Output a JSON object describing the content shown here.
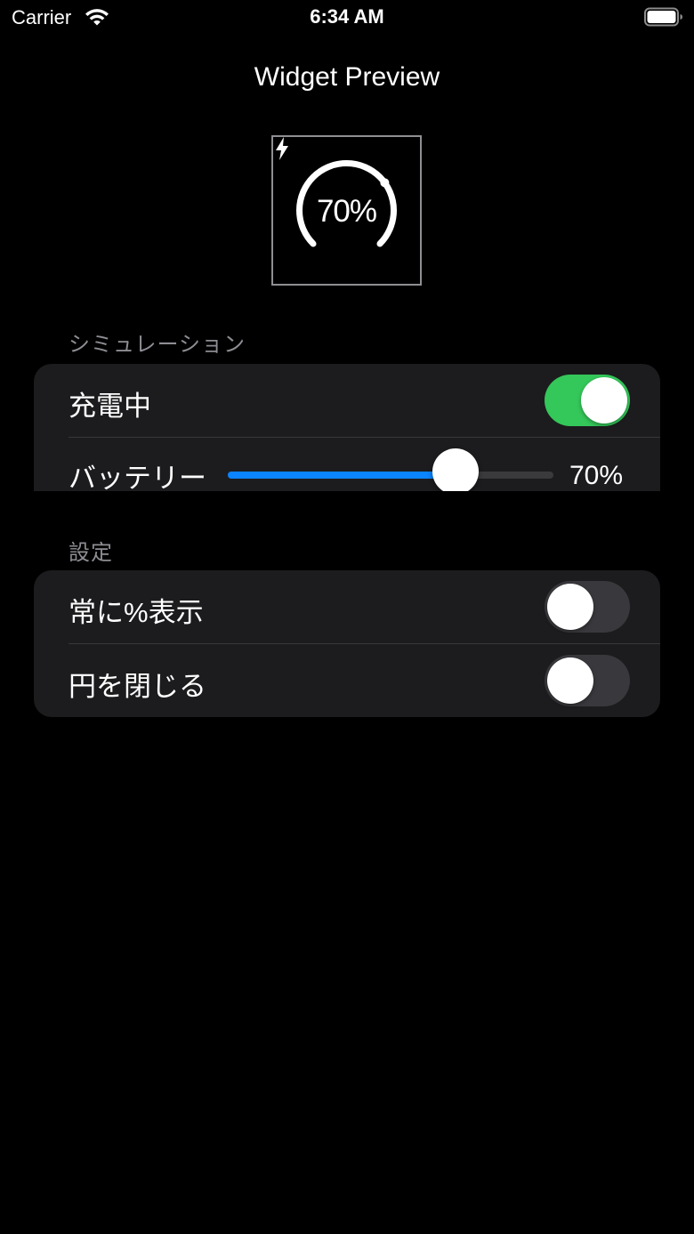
{
  "status_bar": {
    "carrier": "Carrier",
    "time": "6:34 AM"
  },
  "nav": {
    "title": "Widget Preview"
  },
  "widget": {
    "percent_label": "70%",
    "level": 0.7,
    "charging": true
  },
  "simulation": {
    "header": "シミュレーション",
    "charging_label": "充電中",
    "charging_on": true,
    "battery_label": "バッテリー",
    "battery_value_text": "70%",
    "battery_level": 0.7
  },
  "settings": {
    "header": "設定",
    "always_percent_label": "常に%表示",
    "always_percent_on": false,
    "close_circle_label": "円を閉じる",
    "close_circle_on": false
  },
  "colors": {
    "background": "#000000",
    "group_background": "#1c1c1e",
    "toggle_on": "#34c759",
    "toggle_off": "#39393d",
    "slider_fill": "#0a84ff",
    "secondary_text": "#8d8d93"
  },
  "icons": [
    "wifi-icon",
    "battery-icon",
    "bolt-icon"
  ]
}
